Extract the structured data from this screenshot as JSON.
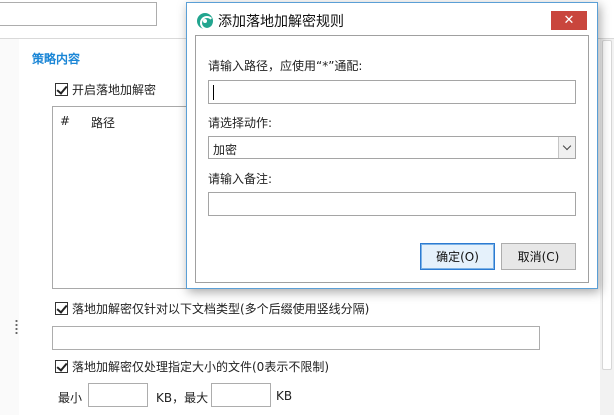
{
  "background": {
    "section_title": "策略内容",
    "enable_checkbox": {
      "label": "开启落地加解密",
      "checked": true
    },
    "path_table": {
      "columns": [
        "#",
        "路径"
      ]
    },
    "filetype_checkbox": {
      "label": "落地加解密仅针对以下文档类型(多个后缀使用竖线分隔)",
      "checked": true
    },
    "filetype_input": {
      "value": ""
    },
    "size_checkbox": {
      "label": "落地加解密仅处理指定大小的文件(0表示不限制)",
      "checked": true
    },
    "size_min_label": "最小",
    "size_min_unit": "KB，最大",
    "size_max_unit": "KB",
    "size_min_value": "",
    "size_max_value": ""
  },
  "dialog": {
    "title": "添加落地加解密规则",
    "close_label": "✕",
    "path_label": "请输入路径，应使用“*”通配:",
    "path_value": "",
    "action_label": "请选择动作:",
    "action_selected": "加密",
    "note_label": "请输入备注:",
    "note_value": "",
    "ok_label": "确定(O)",
    "cancel_label": "取消(C)"
  },
  "colors": {
    "accent": "#1b86d6",
    "close_button": "#c9463d",
    "app_icon": "#22a58f"
  }
}
